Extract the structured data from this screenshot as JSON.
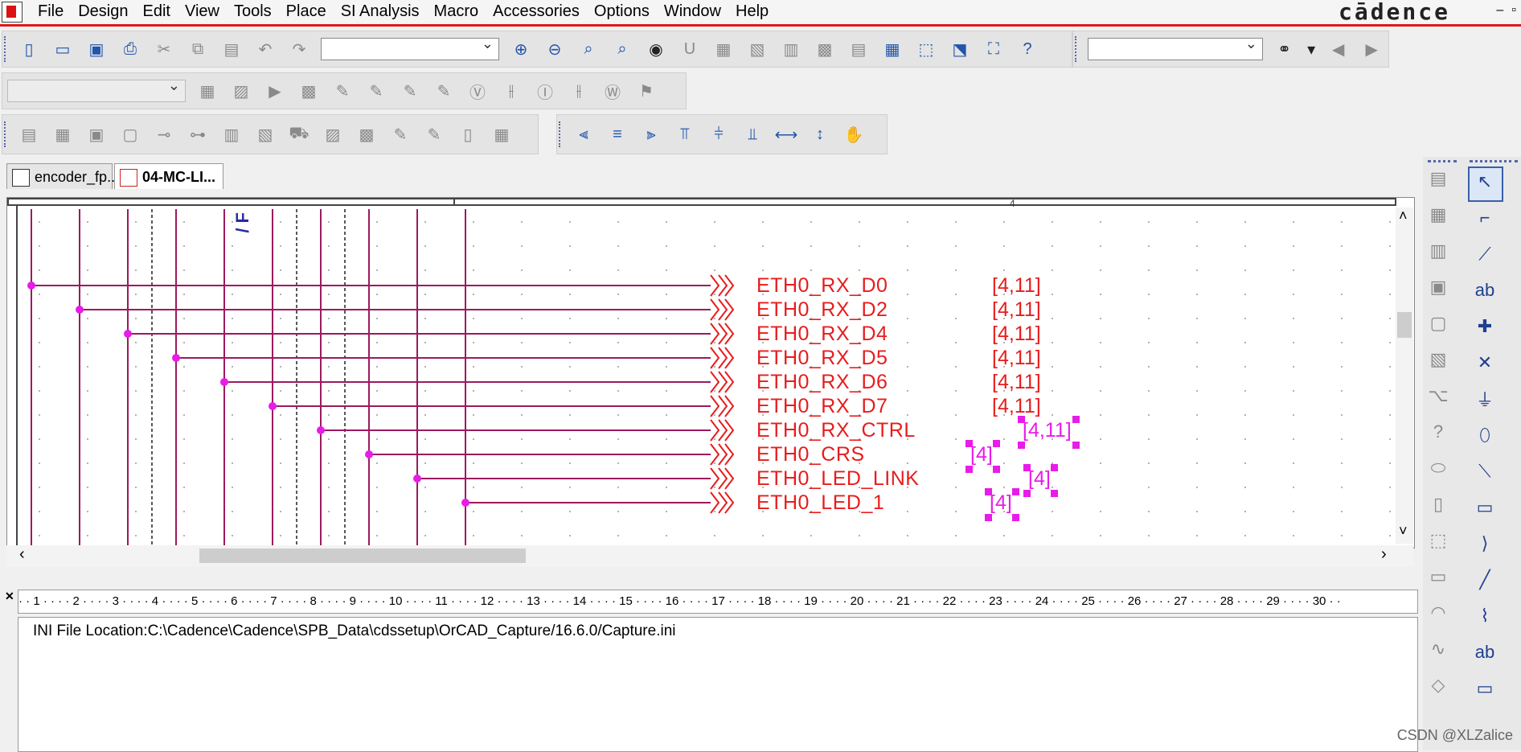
{
  "menu": [
    "File",
    "Design",
    "Edit",
    "View",
    "Tools",
    "Place",
    "SI Analysis",
    "Macro",
    "Accessories",
    "Options",
    "Window",
    "Help"
  ],
  "brand": "cādence",
  "window_controls": [
    "–",
    "▫"
  ],
  "toolbar1": {
    "icons_left": [
      "new-icon",
      "open-icon",
      "save-icon",
      "print-icon",
      "cut-icon",
      "copy-icon",
      "paste-icon",
      "undo-icon",
      "redo-icon"
    ],
    "icons_right": [
      "zoom-in-icon",
      "zoom-out-icon",
      "zoom-area-icon",
      "zoom-all-icon",
      "eye-icon",
      "annotate-icon",
      "back-annotate-icon",
      "drc-icon",
      "netlist-icon",
      "cross-reference-icon",
      "bom-icon",
      "snap-grid-icon",
      "area-select-icon",
      "drag-icon",
      "project-manager-icon",
      "help-icon"
    ],
    "search_icon": "binoculars-icon"
  },
  "toolbar2": {
    "icons": [
      "sim-1-icon",
      "sim-2-icon",
      "run-icon",
      "sim-3-icon",
      "probe-1-icon",
      "probe-2-icon",
      "probe-3-icon",
      "probe-4-icon",
      "v-marker-icon",
      "v-diff-icon",
      "i-marker-icon",
      "i-diff-icon",
      "w-marker-icon",
      "bias-icon"
    ]
  },
  "toolbar3": {
    "icons": [
      "lib-1-icon",
      "lib-2-icon",
      "lib-3-icon",
      "lib-4-icon",
      "lib-5-icon",
      "lib-6-icon",
      "lib-7-icon",
      "lib-8-icon",
      "cart-icon",
      "lib-9-icon",
      "lib-10-icon",
      "lib-11-icon",
      "lib-12-icon",
      "lib-13-icon",
      "lib-14-icon"
    ],
    "align_icons": [
      "align-left-icon",
      "align-center-icon",
      "align-right-icon",
      "align-top-icon",
      "align-middle-icon",
      "align-bottom-icon",
      "distribute-h-icon",
      "distribute-v-icon",
      "hand-icon"
    ]
  },
  "tabs": [
    {
      "label": "encoder_fp...",
      "active": false
    },
    {
      "label": "04-MC-LI...",
      "active": true
    }
  ],
  "schematic": {
    "vertical_label": "/ F",
    "top_ruler_mark": "4",
    "nets": [
      {
        "name": "ETH0_RX_D0",
        "ref": "[4,11]",
        "selected": false
      },
      {
        "name": "ETH0_RX_D2",
        "ref": "[4,11]",
        "selected": false
      },
      {
        "name": "ETH0_RX_D4",
        "ref": "[4,11]",
        "selected": false
      },
      {
        "name": "ETH0_RX_D5",
        "ref": "[4,11]",
        "selected": false
      },
      {
        "name": "ETH0_RX_D6",
        "ref": "[4,11]",
        "selected": false
      },
      {
        "name": "ETH0_RX_D7",
        "ref": "[4,11]",
        "selected": false
      },
      {
        "name": "ETH0_RX_CTRL",
        "ref": "[4,11]",
        "selected": true
      },
      {
        "name": "ETH0_CRS",
        "ref": "[4]",
        "selected": true
      },
      {
        "name": "ETH0_LED_LINK",
        "ref": "[4]",
        "selected": true
      },
      {
        "name": "ETH0_LED_1",
        "ref": "[4]",
        "selected": true
      }
    ],
    "colors": {
      "wire": "#9c1a5e",
      "net_text": "#e81c1c",
      "selected": "#e81ce8",
      "junction": "#e81ce8"
    }
  },
  "ruler": {
    "ticks": [
      "1",
      "2",
      "3",
      "4",
      "5",
      "6",
      "7",
      "8",
      "9",
      "10",
      "11",
      "12",
      "13",
      "14",
      "15",
      "16",
      "17",
      "18",
      "19",
      "20",
      "21",
      "22",
      "23",
      "24",
      "25",
      "26",
      "27",
      "28",
      "29",
      "30"
    ]
  },
  "session_log": {
    "text": "INI File Location:C:\\Cadence\\Cadence\\SPB_Data\\cdssetup\\OrCAD_Capture/16.6.0/Capture.ini"
  },
  "palette": {
    "left_col": [
      "part-grey-icon",
      "ground-grey-icon",
      "page-grey-icon",
      "sheet-grey-icon",
      "print-grey-icon",
      "zoom-grey-icon",
      "hier-grey-icon",
      "help-grey-icon",
      "shape-icon",
      "place-part-icon",
      "select-icon",
      "monitor-icon",
      "arc-icon",
      "wave-icon",
      "diamond-icon"
    ],
    "right_col": [
      "pointer-icon",
      "wire-icon",
      "bus-entry-icon",
      "net-alias-icon",
      "junction-icon",
      "no-connect-icon",
      "power-icon",
      "ellipse-icon",
      "bus-icon",
      "port-icon",
      "offpage-icon",
      "line-icon",
      "polyline-icon",
      "text-icon",
      "rect-icon"
    ]
  },
  "watermark": "CSDN @XLZalice"
}
